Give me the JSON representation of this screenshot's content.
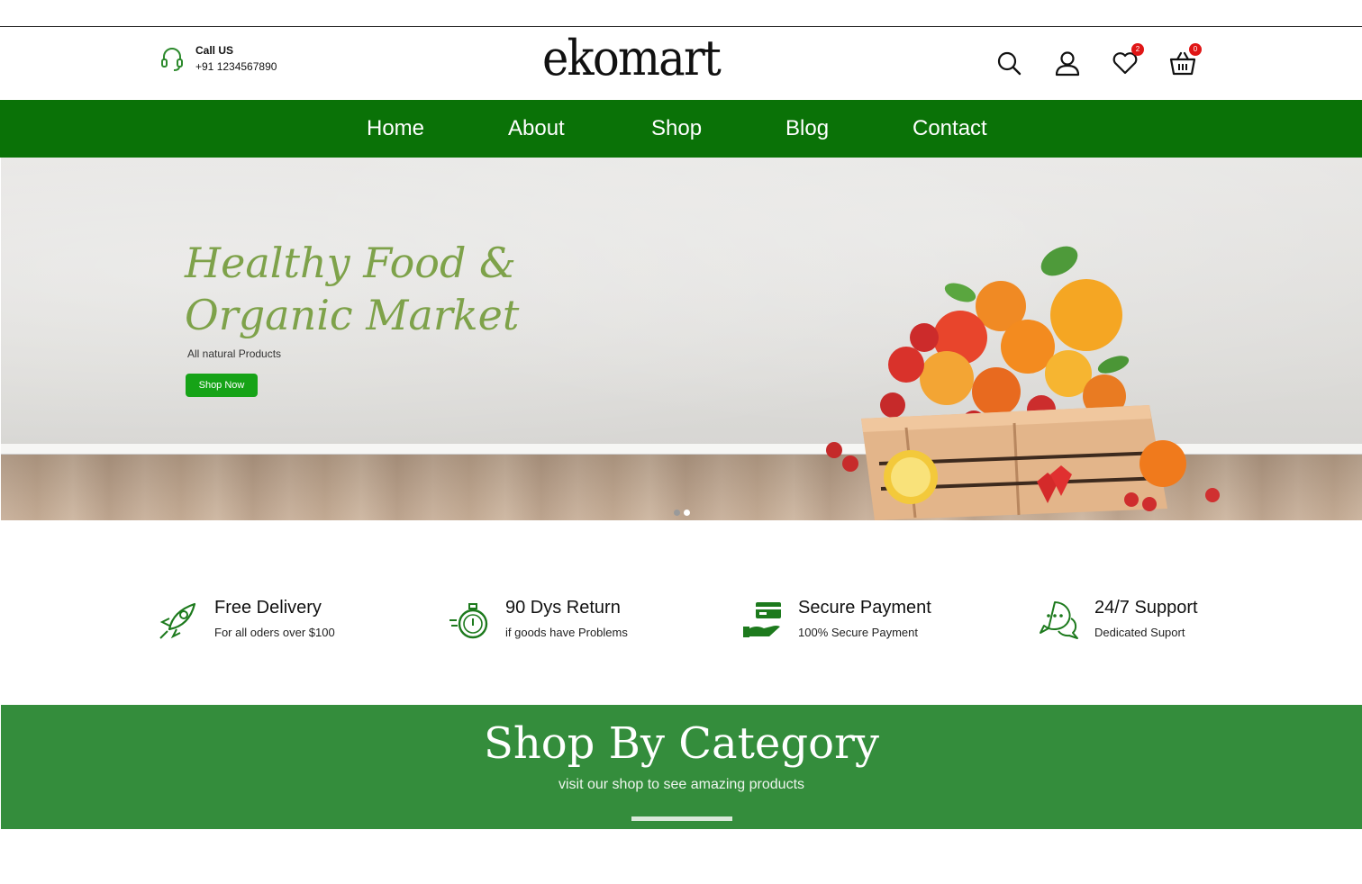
{
  "header": {
    "call_label": "Call US",
    "call_phone": "+91 1234567890",
    "logo": "ekomart",
    "icons": {
      "search": "search-icon",
      "account": "user-icon",
      "wishlist": "heart-icon",
      "cart": "basket-icon"
    },
    "wishlist_count": "2",
    "cart_count": "0"
  },
  "nav": {
    "items": [
      {
        "label": "Home"
      },
      {
        "label": "About"
      },
      {
        "label": "Shop"
      },
      {
        "label": "Blog"
      },
      {
        "label": "Contact"
      }
    ]
  },
  "hero": {
    "title_line1": "Healthy Food &",
    "title_line2": "Organic Market",
    "subtitle": "All natural Products",
    "cta_label": "Shop Now",
    "slides_total": 2,
    "active_slide": 2
  },
  "features": [
    {
      "icon": "rocket-icon",
      "title": "Free Delivery",
      "subtitle": "For all oders over $100"
    },
    {
      "icon": "stopwatch-icon",
      "title": "90 Dys Return",
      "subtitle": "if goods have Problems"
    },
    {
      "icon": "card-hand-icon",
      "title": "Secure Payment",
      "subtitle": "100% Secure Payment"
    },
    {
      "icon": "chat-icon",
      "title": "24/7 Support",
      "subtitle": "Dedicated Suport"
    }
  ],
  "category": {
    "title": "Shop By Category",
    "subtitle": "visit our shop to see amazing products"
  },
  "colors": {
    "nav_green": "#0a7207",
    "cta_green": "#16a317",
    "hero_title_green": "#7ea24a",
    "category_green": "#348d3c",
    "badge_red": "#e01616"
  }
}
